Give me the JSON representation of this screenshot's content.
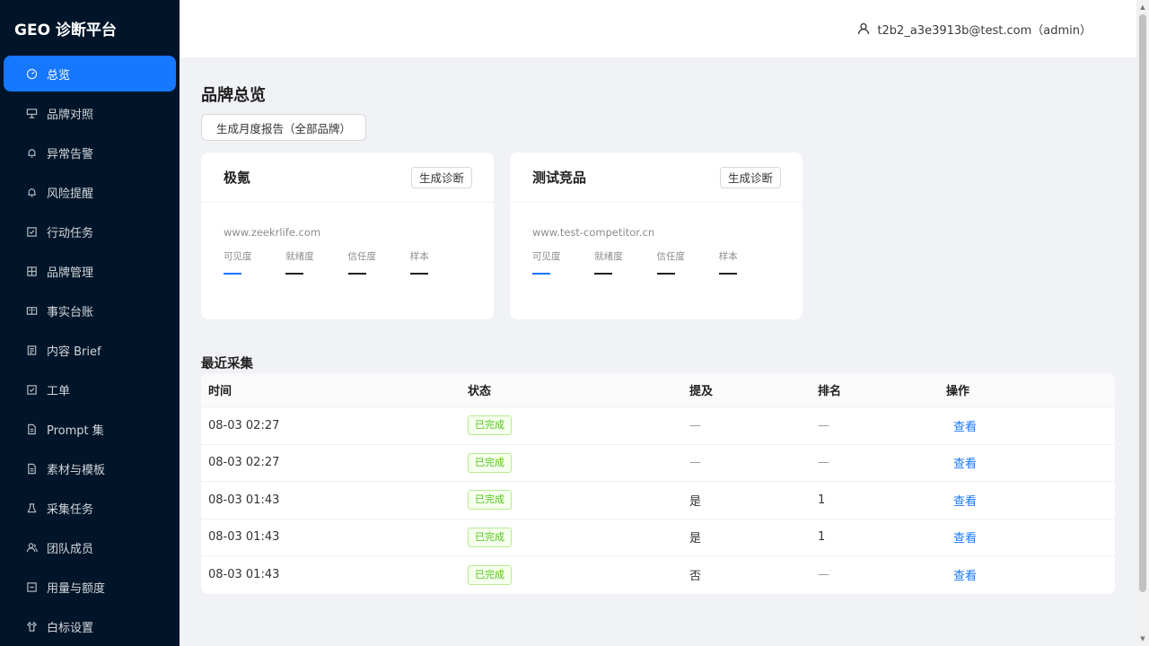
{
  "app": {
    "title": "GEO 诊断平台"
  },
  "sidebar": {
    "items": [
      {
        "label": "总览",
        "icon": "dashboard-icon",
        "active": true
      },
      {
        "label": "品牌对照",
        "icon": "compare-icon"
      },
      {
        "label": "异常告警",
        "icon": "alert-bell-icon"
      },
      {
        "label": "风险提醒",
        "icon": "risk-bell-icon"
      },
      {
        "label": "行动任务",
        "icon": "task-check-icon"
      },
      {
        "label": "品牌管理",
        "icon": "brand-grid-icon"
      },
      {
        "label": "事实台账",
        "icon": "ledger-icon"
      },
      {
        "label": "内容 Brief",
        "icon": "brief-icon"
      },
      {
        "label": "工单",
        "icon": "ticket-icon"
      },
      {
        "label": "Prompt 集",
        "icon": "prompt-doc-icon"
      },
      {
        "label": "素材与模板",
        "icon": "template-doc-icon"
      },
      {
        "label": "采集任务",
        "icon": "collect-icon"
      },
      {
        "label": "团队成员",
        "icon": "team-icon"
      },
      {
        "label": "用量与额度",
        "icon": "usage-icon"
      },
      {
        "label": "白标设置",
        "icon": "whitelabel-icon"
      }
    ]
  },
  "header": {
    "user": "t2b2_a3e3913b@test.com（admin）"
  },
  "main": {
    "title": "品牌总览",
    "report_button": "生成月度报告（全部品牌）",
    "brands": [
      {
        "name": "极氪",
        "button": "生成诊断",
        "url": "www.zeekrlife.com",
        "metrics": [
          {
            "label": "可见度",
            "value": "—"
          },
          {
            "label": "就绪度",
            "value": "—"
          },
          {
            "label": "信任度",
            "value": "—"
          },
          {
            "label": "样本",
            "value": "—"
          }
        ]
      },
      {
        "name": "测试竞品",
        "button": "生成诊断",
        "url": "www.test-competitor.cn",
        "metrics": [
          {
            "label": "可见度",
            "value": "—"
          },
          {
            "label": "就绪度",
            "value": "—"
          },
          {
            "label": "信任度",
            "value": "—"
          },
          {
            "label": "样本",
            "value": "—"
          }
        ]
      }
    ],
    "recent": {
      "title": "最近采集",
      "columns": [
        "时间",
        "状态",
        "提及",
        "排名",
        "操作"
      ],
      "rows": [
        {
          "time": "08-03 02:27",
          "status": "已完成",
          "mention": "—",
          "rank": "—",
          "action": "查看"
        },
        {
          "time": "08-03 02:27",
          "status": "已完成",
          "mention": "—",
          "rank": "—",
          "action": "查看"
        },
        {
          "time": "08-03 01:43",
          "status": "已完成",
          "mention": "是",
          "rank": "1",
          "action": "查看"
        },
        {
          "time": "08-03 01:43",
          "status": "已完成",
          "mention": "是",
          "rank": "1",
          "action": "查看"
        },
        {
          "time": "08-03 01:43",
          "status": "已完成",
          "mention": "否",
          "rank": "—",
          "action": "查看"
        }
      ]
    }
  },
  "colors": {
    "sidebar_bg": "#001529",
    "accent": "#1677ff",
    "success": "#52c41a"
  }
}
